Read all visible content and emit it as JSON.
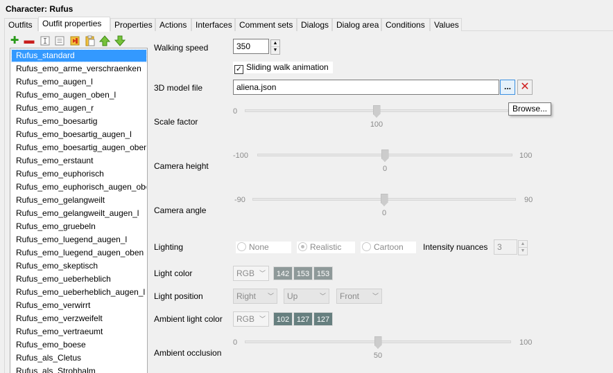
{
  "window_title": "Character: Rufus",
  "tabs": [
    "Outfits",
    "Outfit properties",
    "Properties",
    "Actions",
    "Interfaces",
    "Comment sets",
    "Dialogs",
    "Dialog area",
    "Conditions",
    "Values"
  ],
  "toolbar_icons": [
    "add-icon",
    "remove-icon",
    "rename-icon",
    "duplicate-icon",
    "copy-icon",
    "paste-icon",
    "move-up-icon",
    "move-down-icon"
  ],
  "outfits": [
    "Rufus_standard",
    "Rufus_emo_arme_verschraenken",
    "Rufus_emo_augen_l",
    "Rufus_emo_augen_oben_l",
    "Rufus_emo_augen_r",
    "Rufus_emo_boesartig",
    "Rufus_emo_boesartig_augen_l",
    "Rufus_emo_boesartig_augen_oben",
    "Rufus_emo_erstaunt",
    "Rufus_emo_euphorisch",
    "Rufus_emo_euphorisch_augen_ober",
    "Rufus_emo_gelangweilt",
    "Rufus_emo_gelangweilt_augen_l",
    "Rufus_emo_gruebeln",
    "Rufus_emo_luegend_augen_l",
    "Rufus_emo_luegend_augen_oben",
    "Rufus_emo_skeptisch",
    "Rufus_emo_ueberheblich",
    "Rufus_emo_ueberheblich_augen_l",
    "Rufus_emo_verwirrt",
    "Rufus_emo_verzweifelt",
    "Rufus_emo_vertraeumt",
    "Rufus_emo_boese",
    "Rufus_als_Cletus",
    "Rufus_als_Strohhalm"
  ],
  "selected_outfit": "Rufus_standard",
  "walking_speed": {
    "label": "Walking speed",
    "value": "350"
  },
  "sliding_walk": {
    "label": "Sliding walk animation",
    "checked": true,
    "mark": "✓"
  },
  "model_file": {
    "label": "3D model file",
    "value": "aliena.json",
    "browse_label": "...",
    "browse_tooltip": "Browse...",
    "remove_label": "✕"
  },
  "scale_factor": {
    "label": "Scale factor",
    "min": "0",
    "max": "",
    "value": "100",
    "fraction": 0.5
  },
  "camera_height": {
    "label": "Camera height",
    "min": "-100",
    "max": "100",
    "value": "0",
    "fraction": 0.5
  },
  "camera_angle": {
    "label": "Camera angle",
    "min": "-90",
    "max": "90",
    "value": "0",
    "fraction": 0.5
  },
  "lighting": {
    "label": "Lighting",
    "options": [
      "None",
      "Realistic",
      "Cartoon"
    ],
    "selected": "Realistic",
    "intensity_label": "Intensity nuances",
    "intensity_value": "3"
  },
  "light_color": {
    "label": "Light color",
    "mode": "RGB",
    "r": "142",
    "g": "153",
    "b": "153",
    "color": "#8e9999"
  },
  "light_position": {
    "label": "Light position",
    "x": "Right",
    "y": "Up",
    "z": "Front"
  },
  "ambient_light_color": {
    "label": "Ambient light color",
    "mode": "RGB",
    "r": "102",
    "g": "127",
    "b": "127",
    "color": "#667f7f"
  },
  "ambient_occlusion": {
    "label": "Ambient occlusion",
    "min": "0",
    "max": "100",
    "value": "50",
    "fraction": 0.5
  }
}
